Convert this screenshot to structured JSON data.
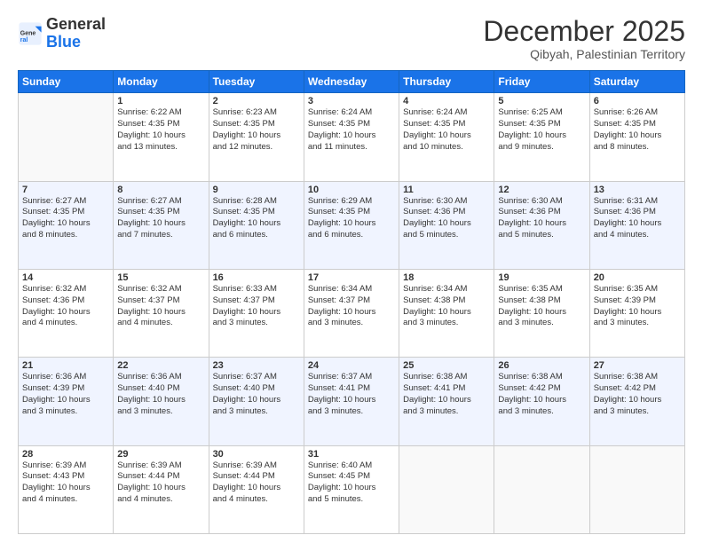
{
  "header": {
    "logo_general": "General",
    "logo_blue": "Blue",
    "month": "December 2025",
    "location": "Qibyah, Palestinian Territory"
  },
  "days_of_week": [
    "Sunday",
    "Monday",
    "Tuesday",
    "Wednesday",
    "Thursday",
    "Friday",
    "Saturday"
  ],
  "weeks": [
    [
      {
        "day": "",
        "info": ""
      },
      {
        "day": "1",
        "info": "Sunrise: 6:22 AM\nSunset: 4:35 PM\nDaylight: 10 hours\nand 13 minutes."
      },
      {
        "day": "2",
        "info": "Sunrise: 6:23 AM\nSunset: 4:35 PM\nDaylight: 10 hours\nand 12 minutes."
      },
      {
        "day": "3",
        "info": "Sunrise: 6:24 AM\nSunset: 4:35 PM\nDaylight: 10 hours\nand 11 minutes."
      },
      {
        "day": "4",
        "info": "Sunrise: 6:24 AM\nSunset: 4:35 PM\nDaylight: 10 hours\nand 10 minutes."
      },
      {
        "day": "5",
        "info": "Sunrise: 6:25 AM\nSunset: 4:35 PM\nDaylight: 10 hours\nand 9 minutes."
      },
      {
        "day": "6",
        "info": "Sunrise: 6:26 AM\nSunset: 4:35 PM\nDaylight: 10 hours\nand 8 minutes."
      }
    ],
    [
      {
        "day": "7",
        "info": "Sunrise: 6:27 AM\nSunset: 4:35 PM\nDaylight: 10 hours\nand 8 minutes."
      },
      {
        "day": "8",
        "info": "Sunrise: 6:27 AM\nSunset: 4:35 PM\nDaylight: 10 hours\nand 7 minutes."
      },
      {
        "day": "9",
        "info": "Sunrise: 6:28 AM\nSunset: 4:35 PM\nDaylight: 10 hours\nand 6 minutes."
      },
      {
        "day": "10",
        "info": "Sunrise: 6:29 AM\nSunset: 4:35 PM\nDaylight: 10 hours\nand 6 minutes."
      },
      {
        "day": "11",
        "info": "Sunrise: 6:30 AM\nSunset: 4:36 PM\nDaylight: 10 hours\nand 5 minutes."
      },
      {
        "day": "12",
        "info": "Sunrise: 6:30 AM\nSunset: 4:36 PM\nDaylight: 10 hours\nand 5 minutes."
      },
      {
        "day": "13",
        "info": "Sunrise: 6:31 AM\nSunset: 4:36 PM\nDaylight: 10 hours\nand 4 minutes."
      }
    ],
    [
      {
        "day": "14",
        "info": "Sunrise: 6:32 AM\nSunset: 4:36 PM\nDaylight: 10 hours\nand 4 minutes."
      },
      {
        "day": "15",
        "info": "Sunrise: 6:32 AM\nSunset: 4:37 PM\nDaylight: 10 hours\nand 4 minutes."
      },
      {
        "day": "16",
        "info": "Sunrise: 6:33 AM\nSunset: 4:37 PM\nDaylight: 10 hours\nand 3 minutes."
      },
      {
        "day": "17",
        "info": "Sunrise: 6:34 AM\nSunset: 4:37 PM\nDaylight: 10 hours\nand 3 minutes."
      },
      {
        "day": "18",
        "info": "Sunrise: 6:34 AM\nSunset: 4:38 PM\nDaylight: 10 hours\nand 3 minutes."
      },
      {
        "day": "19",
        "info": "Sunrise: 6:35 AM\nSunset: 4:38 PM\nDaylight: 10 hours\nand 3 minutes."
      },
      {
        "day": "20",
        "info": "Sunrise: 6:35 AM\nSunset: 4:39 PM\nDaylight: 10 hours\nand 3 minutes."
      }
    ],
    [
      {
        "day": "21",
        "info": "Sunrise: 6:36 AM\nSunset: 4:39 PM\nDaylight: 10 hours\nand 3 minutes."
      },
      {
        "day": "22",
        "info": "Sunrise: 6:36 AM\nSunset: 4:40 PM\nDaylight: 10 hours\nand 3 minutes."
      },
      {
        "day": "23",
        "info": "Sunrise: 6:37 AM\nSunset: 4:40 PM\nDaylight: 10 hours\nand 3 minutes."
      },
      {
        "day": "24",
        "info": "Sunrise: 6:37 AM\nSunset: 4:41 PM\nDaylight: 10 hours\nand 3 minutes."
      },
      {
        "day": "25",
        "info": "Sunrise: 6:38 AM\nSunset: 4:41 PM\nDaylight: 10 hours\nand 3 minutes."
      },
      {
        "day": "26",
        "info": "Sunrise: 6:38 AM\nSunset: 4:42 PM\nDaylight: 10 hours\nand 3 minutes."
      },
      {
        "day": "27",
        "info": "Sunrise: 6:38 AM\nSunset: 4:42 PM\nDaylight: 10 hours\nand 3 minutes."
      }
    ],
    [
      {
        "day": "28",
        "info": "Sunrise: 6:39 AM\nSunset: 4:43 PM\nDaylight: 10 hours\nand 4 minutes."
      },
      {
        "day": "29",
        "info": "Sunrise: 6:39 AM\nSunset: 4:44 PM\nDaylight: 10 hours\nand 4 minutes."
      },
      {
        "day": "30",
        "info": "Sunrise: 6:39 AM\nSunset: 4:44 PM\nDaylight: 10 hours\nand 4 minutes."
      },
      {
        "day": "31",
        "info": "Sunrise: 6:40 AM\nSunset: 4:45 PM\nDaylight: 10 hours\nand 5 minutes."
      },
      {
        "day": "",
        "info": ""
      },
      {
        "day": "",
        "info": ""
      },
      {
        "day": "",
        "info": ""
      }
    ]
  ]
}
